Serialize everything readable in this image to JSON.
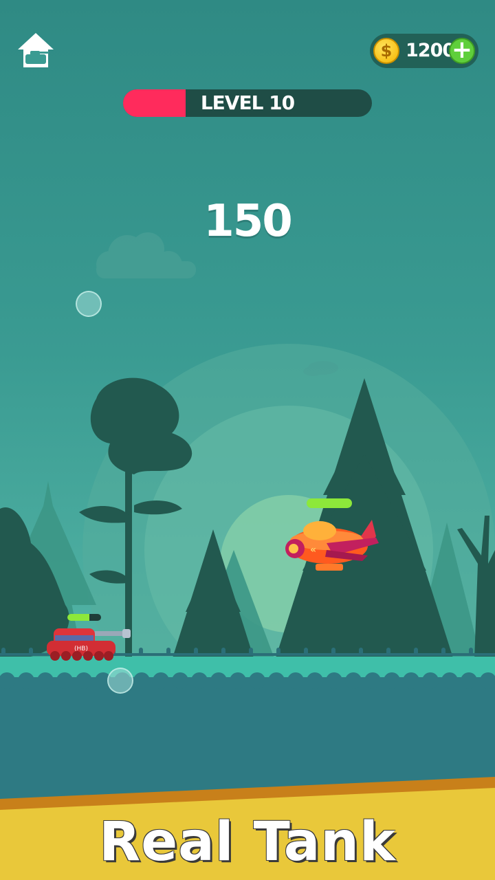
{
  "hud": {
    "home_icon": "home-tank-icon",
    "coins": {
      "icon": "dollar-coin-icon",
      "symbol": "$",
      "amount": "1200",
      "add_label": "+"
    },
    "level": {
      "label": "LEVEL 10",
      "progress": 0.25,
      "fill_color": "#ff2b5c",
      "track_color": "#1f4d46"
    },
    "score": "150"
  },
  "units": {
    "player_tank": {
      "badge": "(HB)",
      "health": 0.65,
      "color": "#e0343a"
    },
    "enemy_plane": {
      "health": 1.0,
      "color": "#ff5a1f"
    }
  },
  "banner": {
    "title": "Real Tank",
    "color": "#e9c83a"
  },
  "colors": {
    "health_bar": "#8de83a",
    "ground_top": "#3fbfa9",
    "ground": "#2e7a83"
  }
}
